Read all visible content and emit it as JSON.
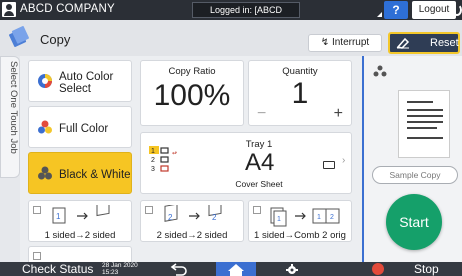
{
  "topbar": {
    "company": "ABCD COMPANY",
    "login_status": "Logged in: [ABCD COMPANY]",
    "help_label": "?",
    "logout_label": "Logout"
  },
  "header": {
    "title": "Copy",
    "interrupt_label": "Interrupt",
    "reset_label": "Reset"
  },
  "sidetab": {
    "label": "Select One Touch Job"
  },
  "color_modes": [
    {
      "label_line1": "Auto Color",
      "label_line2": "Select",
      "icon": "auto-color-icon"
    },
    {
      "label_line1": "Full Color",
      "label_line2": "",
      "icon": "full-color-icon"
    },
    {
      "label_line1": "Black & White",
      "label_line2": "",
      "icon": "black-white-icon",
      "selected": true
    }
  ],
  "copy_ratio": {
    "caption": "Copy Ratio",
    "value": "100%"
  },
  "quantity": {
    "caption": "Quantity",
    "value": "1",
    "minus": "−",
    "plus": "+"
  },
  "tray": {
    "caption": "Tray 1",
    "size": "A4",
    "cover": "Cover Sheet",
    "chevron": "›",
    "tray_numbers": [
      "1",
      "2",
      "3"
    ]
  },
  "duplex": [
    {
      "label": "1 sided→2 sided"
    },
    {
      "label": "2 sided→2 sided"
    },
    {
      "label": "1 sided→Comb 2 orig"
    }
  ],
  "right_panel": {
    "sample_label": "Sample Copy",
    "start_label": "Start"
  },
  "bottombar": {
    "status_label": "Check Status",
    "date_line1": "28 Jan 2020",
    "date_line2": "15:23",
    "stop_label": "Stop"
  },
  "colors": {
    "accent_blue": "#3b6fd1",
    "reset_border": "#f3c72b",
    "bw_selected": "#f6c523",
    "start_green": "#15a06a",
    "stop_red": "#e34b3b"
  }
}
